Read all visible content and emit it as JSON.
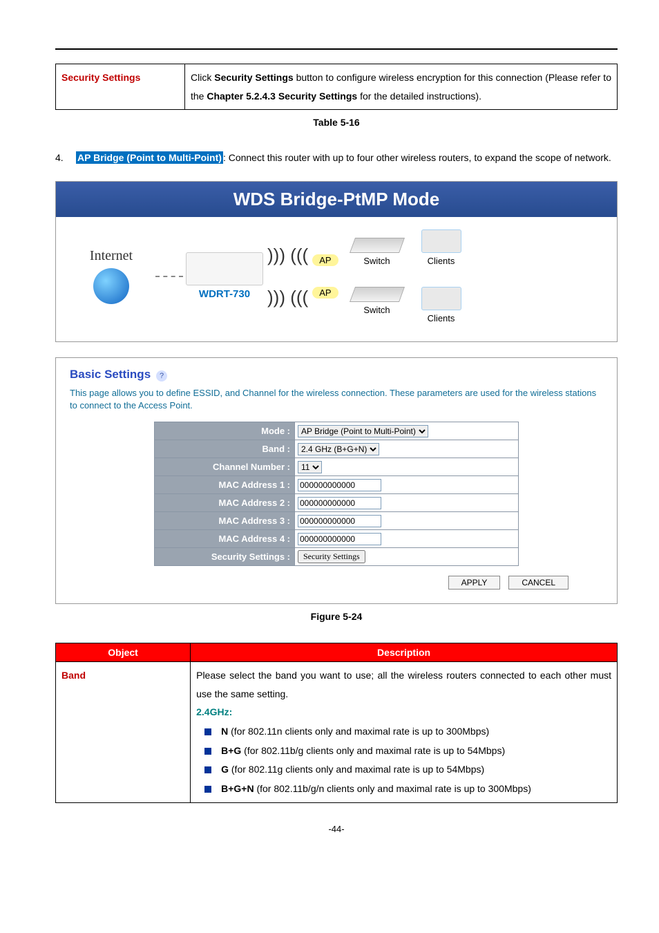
{
  "table516": {
    "left": "Security Settings",
    "right_prefix": "Click ",
    "right_bold1": "Security Settings",
    "right_mid": " button to configure wireless encryption for this connection (Please refer to the ",
    "right_bold2": "Chapter 5.2.4.3 Security Settings",
    "right_suffix": " for the detailed instructions).",
    "caption": "Table 5-16"
  },
  "para": {
    "num": "4.",
    "highlight": "AP Bridge (Point to Multi-Point)",
    "rest": ": Connect this router with up to four other wireless routers, to expand the scope of network."
  },
  "wds": {
    "title": "WDS Bridge-PtMP Mode",
    "internet": "Internet",
    "router": "WDRT-730",
    "ap": "AP",
    "switch": "Switch",
    "clients": "Clients"
  },
  "form": {
    "title": "Basic Settings",
    "desc": "This page allows you to define ESSID, and Channel for the wireless connection. These parameters are used for the wireless stations to connect to the Access Point.",
    "labels": {
      "mode": "Mode :",
      "band": "Band :",
      "channel": "Channel Number :",
      "mac1": "MAC Address 1 :",
      "mac2": "MAC Address 2 :",
      "mac3": "MAC Address 3 :",
      "mac4": "MAC Address 4 :",
      "sec": "Security Settings :"
    },
    "values": {
      "mode": "AP Bridge (Point to Multi-Point)",
      "band": "2.4 GHz (B+G+N)",
      "channel": "11",
      "mac": "000000000000",
      "sec_btn": "Security Settings"
    },
    "buttons": {
      "apply": "APPLY",
      "cancel": "CANCEL"
    }
  },
  "fig_caption": "Figure 5-24",
  "desc_table": {
    "h1": "Object",
    "h2": "Description",
    "band_label": "Band",
    "band_intro": "Please select the band you want to use; all the wireless routers connected to each other must use the same setting.",
    "freq": "2.4GHz:",
    "rows": {
      "n": {
        "b": "N",
        "t": " (for 802.11n clients only and maximal rate is up to 300Mbps)"
      },
      "bg": {
        "b": "B+G",
        "t": " (for 802.11b/g clients only and maximal rate is up to 54Mbps)"
      },
      "g": {
        "b": "G",
        "t": " (for 802.11g clients only and maximal rate is up to 54Mbps)"
      },
      "bgn": {
        "b": "B+G+N",
        "t": " (for 802.11b/g/n clients only and maximal rate is up to 300Mbps)"
      }
    }
  },
  "pagenum": "-44-"
}
